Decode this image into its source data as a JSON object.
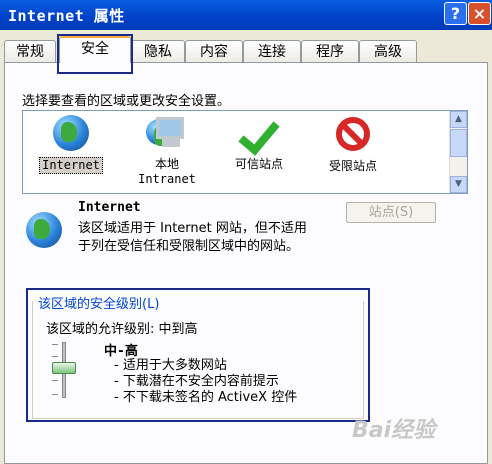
{
  "window": {
    "title": "Internet 属性",
    "help_label": "?",
    "close_label": "×"
  },
  "tabs": [
    {
      "label": "常规"
    },
    {
      "label": "安全"
    },
    {
      "label": "隐私"
    },
    {
      "label": "内容"
    },
    {
      "label": "连接"
    },
    {
      "label": "程序"
    },
    {
      "label": "高级"
    }
  ],
  "active_tab": "安全",
  "instruction": "选择要查看的区域或更改安全设置。",
  "zones": [
    {
      "label": "Internet",
      "icon": "globe-icon",
      "selected": true
    },
    {
      "label_line1": "本地",
      "label_line2": "Intranet",
      "icon": "monitor-icon"
    },
    {
      "label": "可信站点",
      "icon": "check-icon"
    },
    {
      "label": "受限站点",
      "icon": "no-entry-icon"
    }
  ],
  "zone_detail": {
    "name": "Internet",
    "description": "该区域适用于 Internet 网站，但不适用于列在受信任和受限制区域中的网站。",
    "sites_button": "站点(S)"
  },
  "security_level": {
    "group_title": "该区域的安全级别(L)",
    "allowed_level": "该区域的允许级别: 中到高",
    "level_name": "中-高",
    "bullets": [
      "适用于大多数网站",
      "下载潜在不安全内容前提示",
      "不下载未签名的 ActiveX 控件"
    ]
  },
  "watermark": "Bai经验",
  "colors": {
    "titlebar": "#0a5fe0",
    "active_tab_accent": "#f7a93d",
    "group_title": "#0046d5",
    "highlight_box": "#1a2a8a"
  }
}
